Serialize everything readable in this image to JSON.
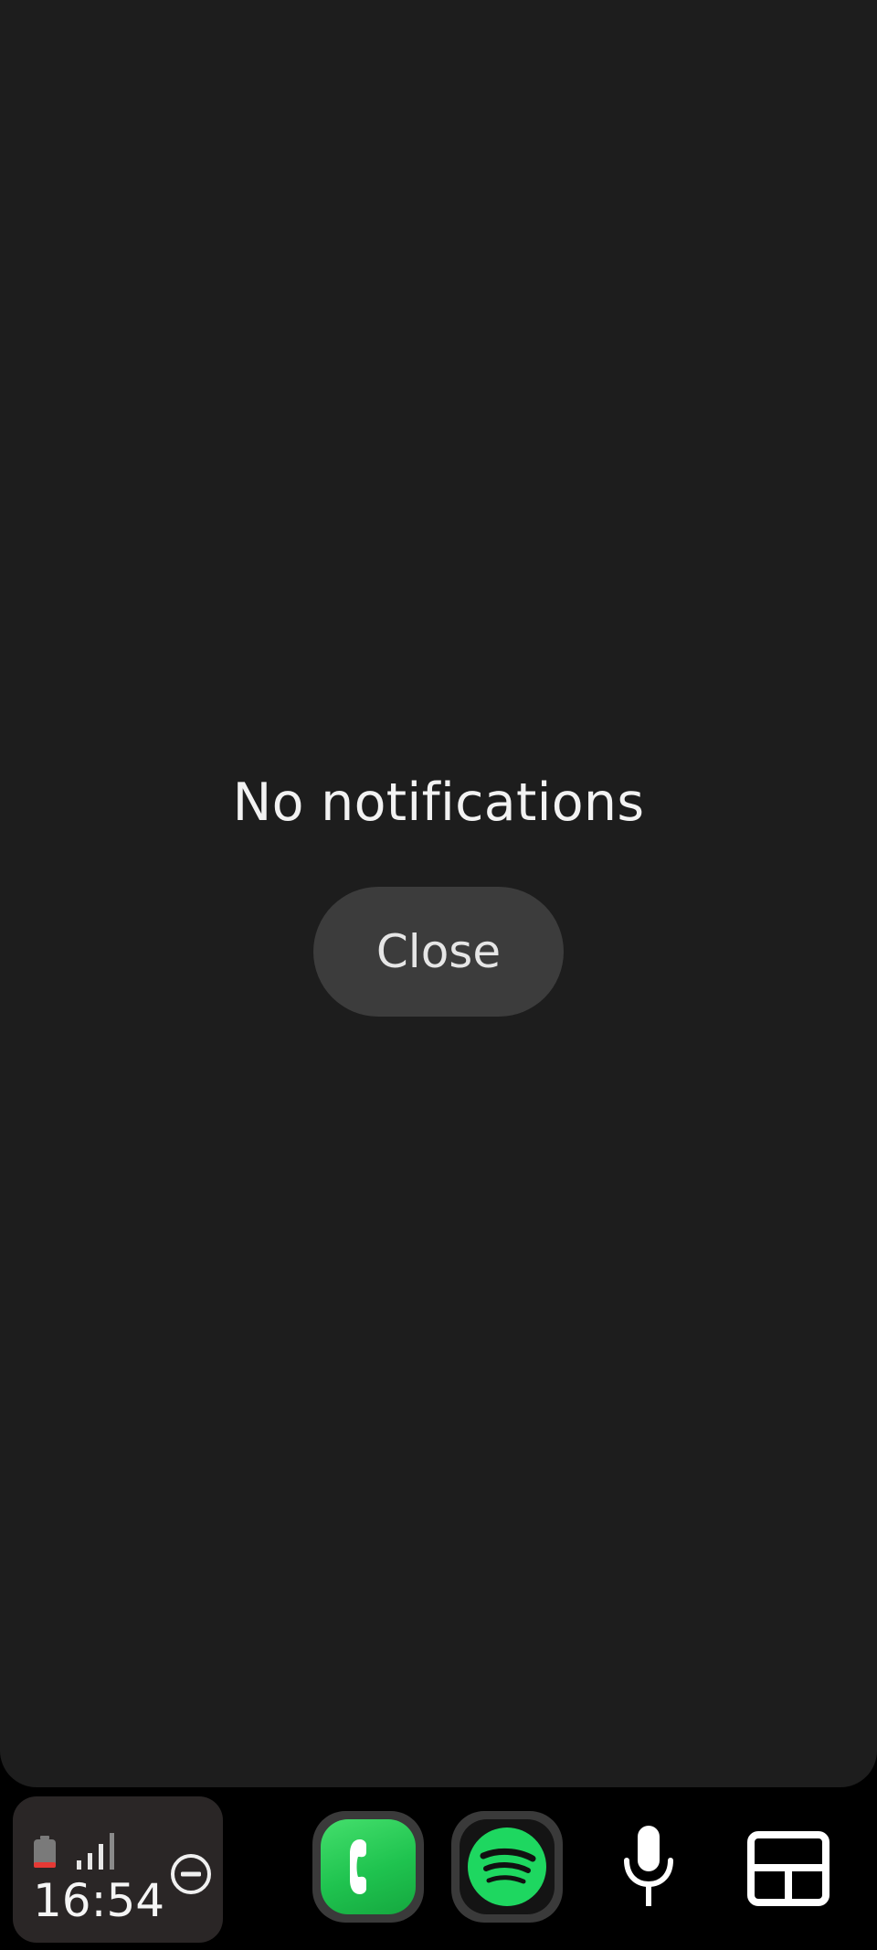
{
  "notification_panel": {
    "empty_message": "No notifications",
    "close_label": "Close"
  },
  "dock": {
    "status": {
      "time": "16:54",
      "battery_icon": "battery-low-icon",
      "signal_icon": "cellular-signal-icon",
      "dnd_icon": "do-not-disturb-icon"
    },
    "apps": [
      {
        "name": "Phone",
        "icon": "phone-icon",
        "color": "#22c553"
      },
      {
        "name": "Spotify",
        "icon": "spotify-icon",
        "color": "#1ed760"
      }
    ],
    "voice_icon": "microphone-icon",
    "layout_icon": "layout-icon"
  },
  "colors": {
    "panel_background": "#1d1d1d",
    "button_background": "#3c3c3c",
    "battery_low": "#e53935",
    "spotify_green": "#1ed760"
  }
}
